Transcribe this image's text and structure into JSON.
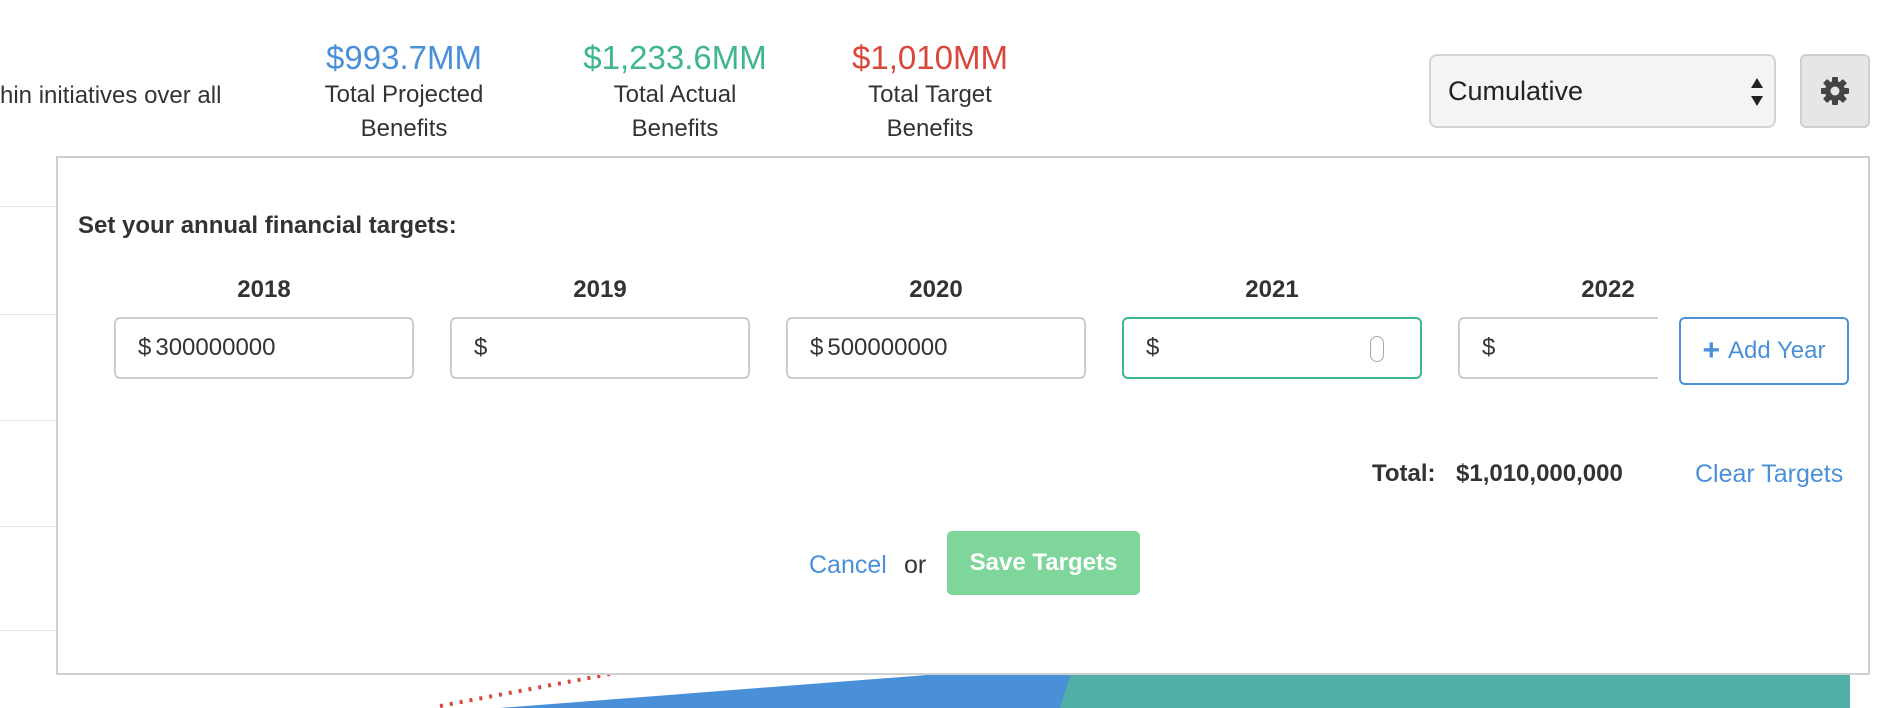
{
  "intro_text": "hin initiatives over all",
  "stats": [
    {
      "value": "$993.7MM",
      "label_line1": "Total Projected",
      "label_line2": "Benefits",
      "color": "#4a90d9"
    },
    {
      "value": "$1,233.6MM",
      "label_line1": "Total Actual",
      "label_line2": "Benefits",
      "color": "#3fb68b"
    },
    {
      "value": "$1,010MM",
      "label_line1": "Total Target",
      "label_line2": "Benefits",
      "color": "#d9473b"
    }
  ],
  "view_select": {
    "selected": "Cumulative"
  },
  "settings": {
    "icon": "gear-icon"
  },
  "targets_panel": {
    "title": "Set your annual financial targets:",
    "currency_symbol": "$",
    "years": [
      {
        "year": "2018",
        "value": "300000000"
      },
      {
        "year": "2019",
        "value": ""
      },
      {
        "year": "2020",
        "value": "500000000"
      },
      {
        "year": "2021",
        "value": ""
      },
      {
        "year": "2022",
        "value": ""
      }
    ],
    "add_year_label": "Add Year",
    "total_label": "Total:",
    "total_value": "$1,010,000,000",
    "clear_label": "Clear Targets",
    "cancel_label": "Cancel",
    "or_label": "or",
    "save_label": "Save Targets"
  },
  "colors": {
    "accent_blue": "#4a90d9",
    "accent_green": "#3fb68b",
    "accent_red": "#d9473b",
    "save_button_green": "#7fd69a"
  }
}
